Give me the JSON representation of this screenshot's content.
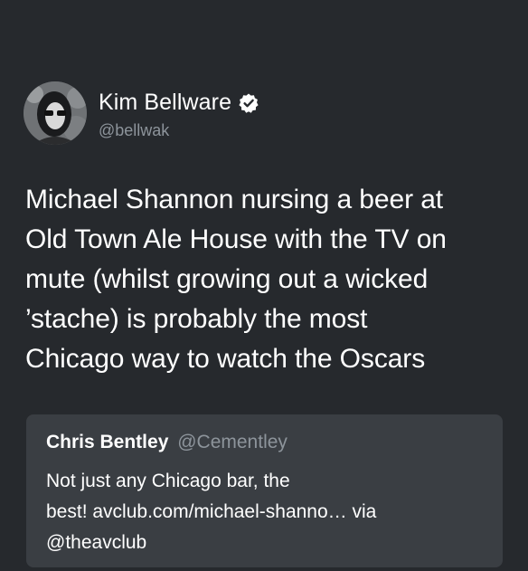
{
  "author": {
    "display_name": "Kim Bellware",
    "handle": "@bellwak",
    "verified_icon": "verified-badge-icon",
    "avatar_icon": "profile-photo"
  },
  "tweet": {
    "lines": [
      "Michael Shannon nursing a beer at",
      "Old Town Ale House with the TV on",
      "mute (whilst growing out a wicked",
      "’stache) is probably the most",
      "Chicago way to watch the Oscars"
    ]
  },
  "quote": {
    "display_name": "Chris Bentley",
    "handle": "@Cementley",
    "lines": [
      "Not just any Chicago bar, the",
      "best! avclub.com/michael-shanno… via",
      "@theavclub"
    ]
  },
  "colors": {
    "background": "#26292d",
    "card": "#3a3e43",
    "secondary_text": "#8d949b",
    "primary_text": "#ffffff"
  }
}
